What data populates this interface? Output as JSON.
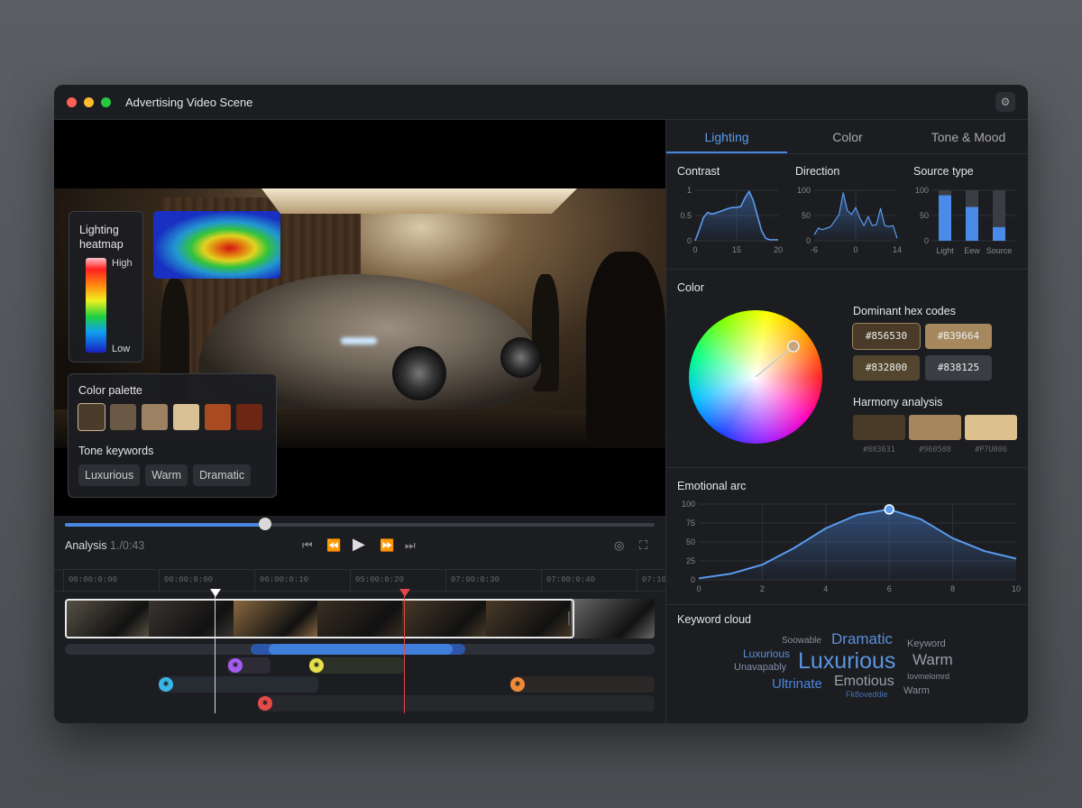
{
  "window": {
    "title": "Advertising Video Scene",
    "settings_icon": "sliders-icon",
    "traffic_colors": [
      "#ff5f57",
      "#febc2e",
      "#28c840"
    ]
  },
  "video": {
    "heatmap": {
      "title": "Lighting heatmap",
      "high": "High",
      "low": "Low"
    },
    "palette": {
      "title": "Color palette",
      "colors": [
        "#4a3b2a",
        "#6a5a45",
        "#9c8262",
        "#d8bf94",
        "#a84a22",
        "#6e2614"
      ]
    },
    "tone": {
      "title": "Tone keywords",
      "tags": [
        "Luxurious",
        "Warm",
        "Dramatic"
      ]
    },
    "progress": 0.34
  },
  "controls": {
    "label": "Analysis",
    "time": "1./0:43",
    "icons": [
      "skip-back-icon",
      "rewind-icon",
      "play-icon",
      "fast-forward-icon",
      "skip-forward-icon",
      "target-icon",
      "fullscreen-icon"
    ]
  },
  "timeline": {
    "ticks": [
      "00:00:0:00",
      "00:00:0:00",
      "06:00:0:10",
      "05:00:0:20",
      "07:00:0:30",
      "07:00:0:40",
      "07:10"
    ],
    "frames": [
      "#5a5448",
      "#3a3430",
      "#8a6a40",
      "#3a2e22",
      "#4a3a28",
      "#4a3a28",
      "#6a6a6a"
    ],
    "tracks": [
      {
        "color": "#a55cf0",
        "icon": "mask-icon"
      },
      {
        "color": "#e6e04a",
        "icon": "sun-icon"
      },
      {
        "color": "#38b6e8",
        "icon": "people-icon"
      },
      {
        "color": "#f08a38",
        "icon": "face-icon"
      },
      {
        "color": "#e84a4a",
        "icon": "flower-icon"
      }
    ]
  },
  "tabs": [
    {
      "label": "Lighting",
      "active": true
    },
    {
      "label": "Color"
    },
    {
      "label": "Tone & Mood"
    }
  ],
  "lighting": {
    "contrast": {
      "title": "Contrast",
      "type": "area",
      "x_ticks": [
        "0",
        "15",
        "20"
      ],
      "y_ticks": [
        "1",
        "0.5",
        "0"
      ],
      "xlim": [
        0,
        20
      ],
      "ylim": [
        0,
        1
      ],
      "x": [
        0,
        1,
        2,
        3,
        4,
        5,
        6,
        7,
        8,
        9,
        10,
        11,
        12,
        13,
        14,
        15,
        16,
        17,
        18,
        19,
        20
      ],
      "y": [
        0,
        0.22,
        0.46,
        0.56,
        0.53,
        0.55,
        0.58,
        0.61,
        0.64,
        0.66,
        0.66,
        0.68,
        0.85,
        0.98,
        0.8,
        0.5,
        0.2,
        0.05,
        0.02,
        0.02,
        0.02
      ]
    },
    "direction": {
      "title": "Direction",
      "type": "area",
      "x_ticks": [
        "-6",
        "0",
        "14"
      ],
      "y_ticks": [
        "100",
        "50",
        "0"
      ],
      "xlim": [
        -6,
        14
      ],
      "ylim": [
        0,
        100
      ],
      "x": [
        -6,
        -5,
        -4,
        -3,
        -2,
        -1,
        0,
        1,
        2,
        3,
        4,
        5,
        6,
        7,
        8,
        9,
        10,
        11,
        12,
        13,
        14
      ],
      "y": [
        12,
        25,
        22,
        25,
        28,
        40,
        52,
        95,
        60,
        52,
        66,
        45,
        30,
        48,
        30,
        32,
        64,
        30,
        28,
        30,
        5
      ]
    },
    "source": {
      "title": "Source type",
      "type": "bar",
      "categories": [
        "Light",
        "Eew",
        "Source"
      ],
      "values": [
        90,
        67,
        27
      ],
      "y_ticks": [
        "100",
        "50",
        "0"
      ],
      "ylim": [
        0,
        100
      ]
    }
  },
  "color": {
    "title": "Color",
    "dominant_title": "Dominant hex codes",
    "hex": [
      {
        "code": "#856530",
        "bg": "#4a3b28"
      },
      {
        "code": "#B39664",
        "bg": "#a5885e"
      },
      {
        "code": "#832800",
        "bg": "#54462e"
      },
      {
        "code": "#838125",
        "bg": "#3a3d42"
      }
    ],
    "harmony_title": "Harmony analysis",
    "harmony": [
      {
        "code": "#883631",
        "bg": "#4a3b28"
      },
      {
        "code": "#960508",
        "bg": "#a8865c"
      },
      {
        "code": "#P7U006",
        "bg": "#dcc08e"
      }
    ]
  },
  "emotional_arc": {
    "title": "Emotional arc",
    "type": "area",
    "xlim": [
      0,
      10
    ],
    "ylim": [
      0,
      100
    ],
    "x_ticks": [
      "0",
      "2",
      "4",
      "6",
      "8",
      "10"
    ],
    "y_ticks": [
      "100",
      "75",
      "50",
      "25",
      "0"
    ],
    "x": [
      0,
      1,
      2,
      3,
      4,
      5,
      6,
      7,
      8,
      9,
      10
    ],
    "y": [
      2,
      8,
      20,
      42,
      68,
      86,
      93,
      80,
      55,
      38,
      28
    ],
    "highlight_x": 6
  },
  "keywords": {
    "title": "Keyword cloud",
    "words": [
      {
        "t": "Soowable",
        "c": "#8a8f98",
        "s": 10
      },
      {
        "t": "Dramatic",
        "c": "#5b8fd8",
        "s": 17
      },
      {
        "t": "Keyword",
        "c": "#8a8f98",
        "s": 11
      },
      {
        "t": "Luxurious",
        "c": "#5b8fd8",
        "s": 12
      },
      {
        "t": "Luxurious",
        "c": "#5b95e0",
        "s": 25
      },
      {
        "t": "Warm",
        "c": "#9aa0a8",
        "s": 17
      },
      {
        "t": "Unavapably",
        "c": "#7f8fa8",
        "s": 11
      },
      {
        "t": "Ultrinate",
        "c": "#4a86e0",
        "s": 15
      },
      {
        "t": "Emotious",
        "c": "#9aa0a8",
        "s": 16
      },
      {
        "t": "Iovmelomrd",
        "c": "#8a8f98",
        "s": 9
      },
      {
        "t": "Warm",
        "c": "#8a8f98",
        "s": 11
      },
      {
        "t": "Fk8oveddie",
        "c": "#4a70b0",
        "s": 9
      }
    ]
  }
}
